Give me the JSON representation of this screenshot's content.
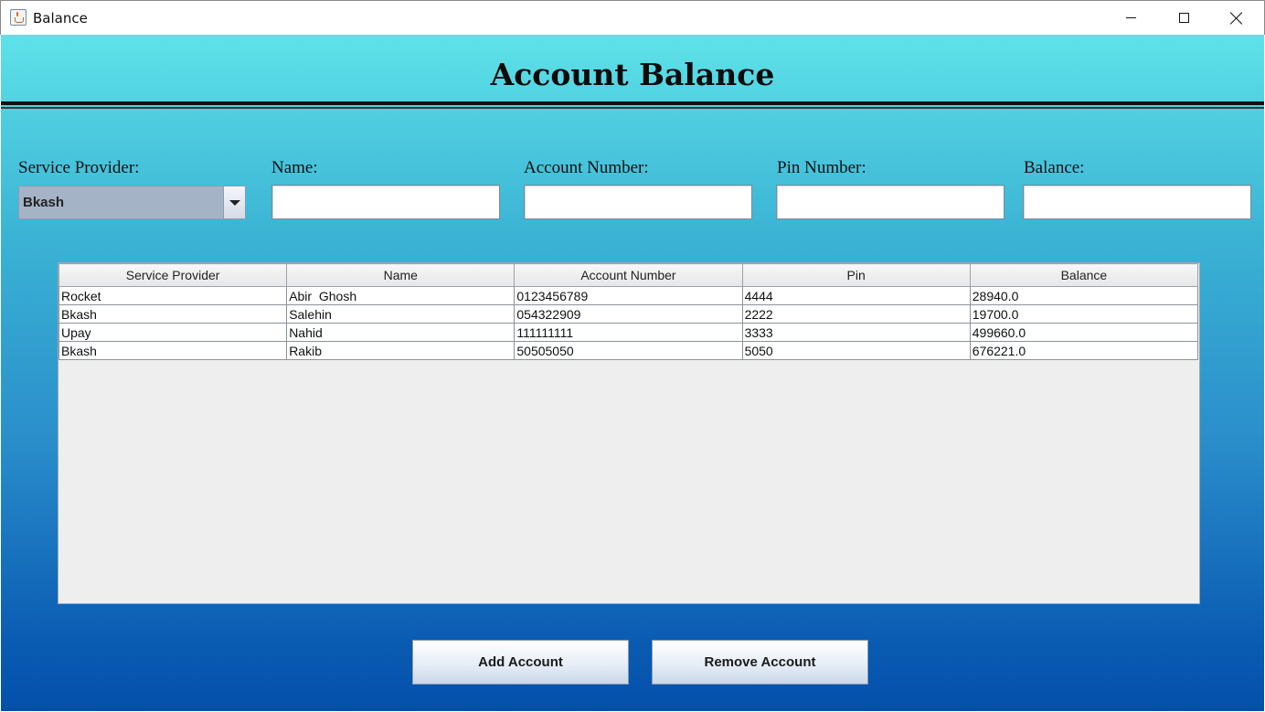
{
  "window": {
    "title": "Balance"
  },
  "header": {
    "title": "Account Balance"
  },
  "form": {
    "service_provider": {
      "label": "Service Provider:",
      "value": "Bkash"
    },
    "name": {
      "label": "Name:",
      "value": ""
    },
    "account_number": {
      "label": "Account Number:",
      "value": ""
    },
    "pin_number": {
      "label": "Pin Number:",
      "value": ""
    },
    "balance": {
      "label": "Balance:",
      "value": ""
    }
  },
  "table": {
    "columns": [
      "Service Provider",
      "Name",
      "Account Number",
      "Pin",
      "Balance"
    ],
    "rows": [
      [
        "Rocket",
        "Abir  Ghosh",
        "0123456789",
        "4444",
        "28940.0"
      ],
      [
        "Bkash",
        "Salehin",
        "054322909",
        "2222",
        "19700.0"
      ],
      [
        "Upay",
        "Nahid",
        "111111111",
        "3333",
        "499660.0"
      ],
      [
        "Bkash",
        "Rakib",
        "50505050",
        "5050",
        "676221.0"
      ]
    ]
  },
  "buttons": {
    "add": "Add Account",
    "remove": "Remove Account"
  }
}
